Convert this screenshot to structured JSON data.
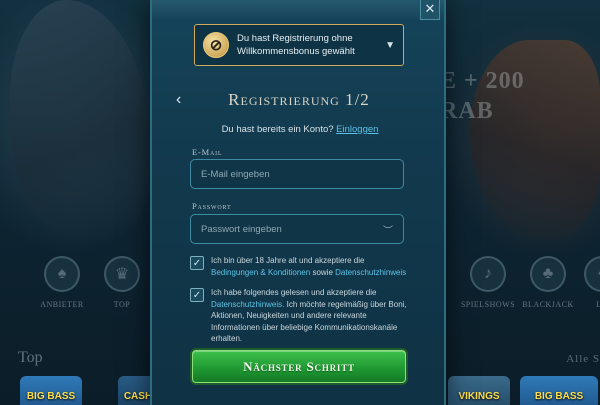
{
  "background": {
    "promo_line1": "E + 200",
    "promo_line2": "RAB",
    "categories": [
      {
        "label": "Anbieter",
        "icon": "mask-icon"
      },
      {
        "label": "Top",
        "icon": "crown-icon"
      },
      {
        "label": "Spielshows",
        "icon": "mic-icon"
      },
      {
        "label": "Blackjack",
        "icon": "cards-icon"
      },
      {
        "label": "La",
        "icon": "card-icon"
      }
    ],
    "section_title": "Top",
    "show_all": "Alle S",
    "tiles": [
      "BIG BASS",
      "CASH",
      "VIKINGS",
      "BIG BASS"
    ]
  },
  "modal": {
    "close_label": "✕",
    "bonus": {
      "icon": "no-bonus-icon",
      "text": "Du hast Registrierung ohne Willkommensbonus gewählt"
    },
    "title": "Registrierung 1/2",
    "account_prompt": "Du hast bereits ein Konto?",
    "login_link": "Einloggen",
    "email": {
      "label": "E-Mail",
      "placeholder": "E-Mail eingeben"
    },
    "password": {
      "label": "Passwort",
      "placeholder": "Passwort eingeben"
    },
    "consent_age": {
      "checked": true,
      "text_prefix": "Ich bin über 18 Jahre alt und akzeptiere die",
      "link_terms": "Bedingungen & Konditionen",
      "text_mid": "sowie",
      "link_privacy": "Datenschutzhinweis"
    },
    "consent_marketing": {
      "checked": true,
      "text_prefix": "Ich habe folgendes gelesen und akzeptiere die",
      "link_privacy": "Datenschutzhinweis.",
      "text_rest": "Ich möchte regelmäßig über Boni, Aktionen, Neuigkeiten und andere relevante Informationen über beliebige Kommunikationskanäle erhalten."
    },
    "next_button": "Nächster Schritt"
  },
  "colors": {
    "accent_link": "#5cc3e6",
    "button_green": "#1f9a33",
    "bonus_border": "#d2a85a"
  }
}
